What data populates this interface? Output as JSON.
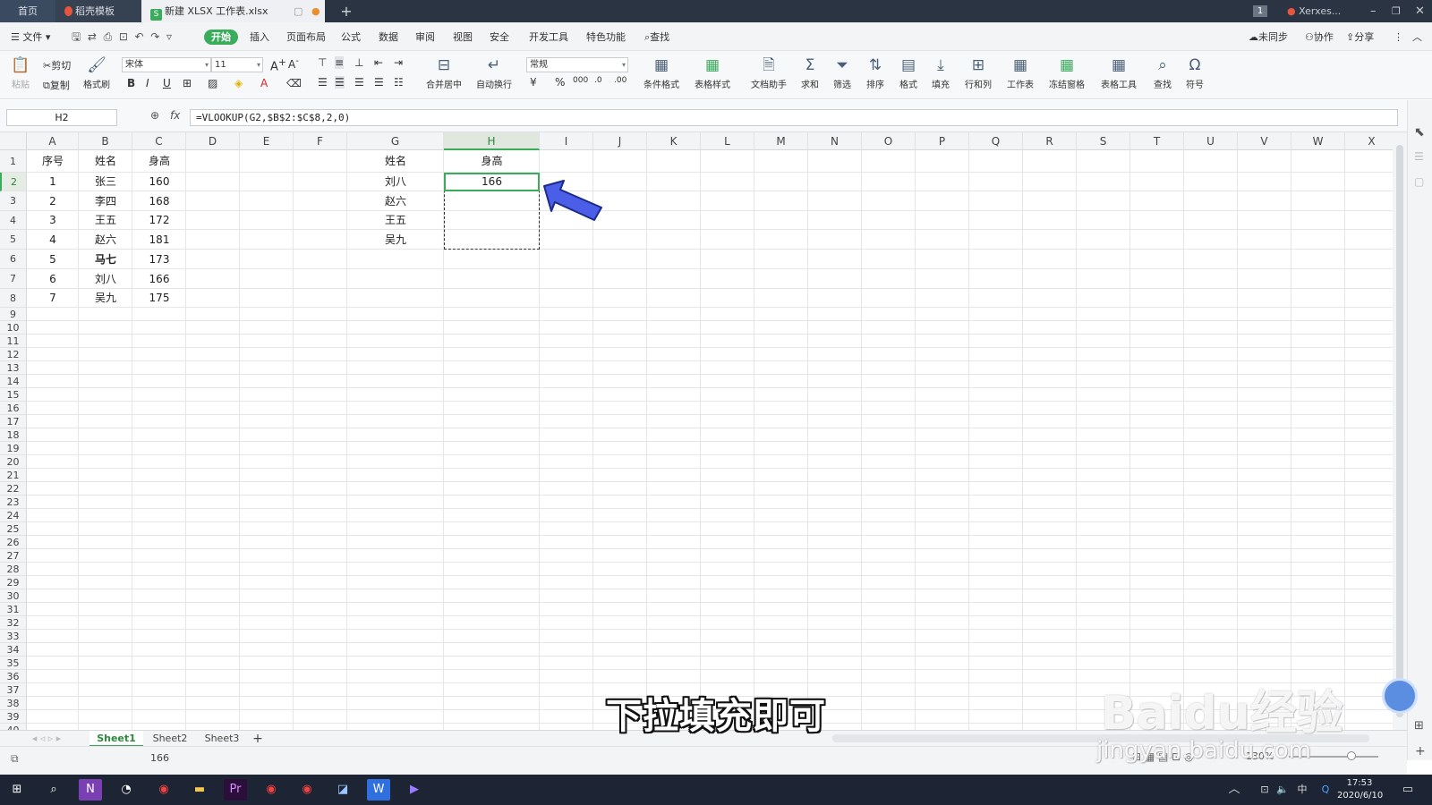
{
  "titlebar": {
    "tabs": [
      {
        "label": "首页"
      },
      {
        "label": "稻壳模板"
      },
      {
        "label": "新建 XLSX 工作表.xlsx"
      }
    ],
    "badge": "1",
    "user": "Xerxes..."
  },
  "menubar": {
    "file": "文件",
    "items": [
      "开始",
      "插入",
      "页面布局",
      "公式",
      "数据",
      "审阅",
      "视图",
      "安全",
      "开发工具",
      "特色功能"
    ],
    "search": "查找",
    "right": [
      "未同步",
      "协作",
      "分享"
    ]
  },
  "ribbon": {
    "paste": "粘贴",
    "cut": "剪切",
    "copy": "复制",
    "format_painter": "格式刷",
    "font_name": "宋体",
    "font_size": "11",
    "merge": "合并居中",
    "wrap": "自动换行",
    "number_format": "常规",
    "cond_format": "条件格式",
    "table_style": "表格样式",
    "doc_helper": "文档助手",
    "sum": "求和",
    "filter": "筛选",
    "sort": "排序",
    "format": "格式",
    "fill": "填充",
    "rowcol": "行和列",
    "worksheet": "工作表",
    "freeze": "冻结窗格",
    "table_tools": "表格工具",
    "find": "查找",
    "symbol": "符号"
  },
  "formula_bar": {
    "cell_ref": "H2",
    "fx": "fx",
    "formula": "=VLOOKUP(G2,$B$2:$C$8,2,0)"
  },
  "sheet": {
    "columns": [
      "A",
      "B",
      "C",
      "D",
      "E",
      "F",
      "G",
      "H",
      "I",
      "J",
      "K",
      "L",
      "M",
      "N",
      "O",
      "P",
      "Q",
      "R",
      "S",
      "T",
      "U",
      "V",
      "W",
      "X"
    ],
    "rows": [
      "1",
      "2",
      "3",
      "4",
      "5",
      "6",
      "7",
      "8",
      "9",
      "10",
      "11",
      "12",
      "13",
      "14",
      "15",
      "16",
      "17",
      "18",
      "19",
      "20",
      "21",
      "22",
      "23",
      "24",
      "25",
      "26",
      "27",
      "28",
      "29",
      "30",
      "31",
      "32",
      "33",
      "34",
      "35",
      "36",
      "37",
      "38",
      "39",
      "40"
    ],
    "table1_header": [
      "序号",
      "姓名",
      "身高"
    ],
    "table1_rows": [
      [
        "1",
        "张三",
        "160"
      ],
      [
        "2",
        "李四",
        "168"
      ],
      [
        "3",
        "王五",
        "172"
      ],
      [
        "4",
        "赵六",
        "181"
      ],
      [
        "5",
        "马七",
        "173"
      ],
      [
        "6",
        "刘八",
        "166"
      ],
      [
        "7",
        "吴九",
        "175"
      ]
    ],
    "lookup_header": [
      "姓名",
      "身高"
    ],
    "lookup_names": [
      "刘八",
      "赵六",
      "王五",
      "吴九"
    ],
    "lookup_values": [
      "166",
      "",
      "",
      ""
    ]
  },
  "sheet_tabs": [
    "Sheet1",
    "Sheet2",
    "Sheet3"
  ],
  "status": {
    "value": "166",
    "zoom": "130%"
  },
  "overlay": {
    "subtitle": "下拉填充即可",
    "watermark_logo": "Baidu经验",
    "watermark_url": "jingyan.baidu.com"
  },
  "taskbar": {
    "time": "17:53",
    "date": "2020/6/10",
    "ime": "中"
  },
  "colors": {
    "accent_green": "#3bab5c",
    "arrow_blue": "#4a5ee8"
  }
}
